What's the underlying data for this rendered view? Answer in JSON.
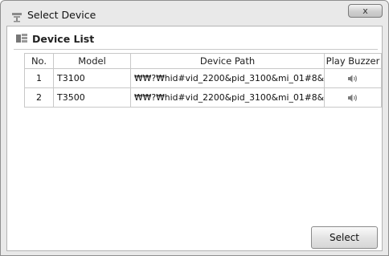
{
  "window": {
    "title": "Select Device",
    "close_label": "x"
  },
  "section": {
    "label": "Device List"
  },
  "table": {
    "columns": [
      "No.",
      "Model",
      "Device Path",
      "Play Buzzer"
    ],
    "rows": [
      {
        "no": "1",
        "model": "T3100",
        "path": "₩₩?₩hid#vid_2200&pid_3100&mi_01#8&1···",
        "buzzer_icon": "speaker-icon"
      },
      {
        "no": "2",
        "model": "T3500",
        "path": "₩₩?₩hid#vid_2200&pid_3100&mi_01#8&1···",
        "buzzer_icon": "speaker-icon"
      }
    ]
  },
  "footer": {
    "select_label": "Select"
  }
}
